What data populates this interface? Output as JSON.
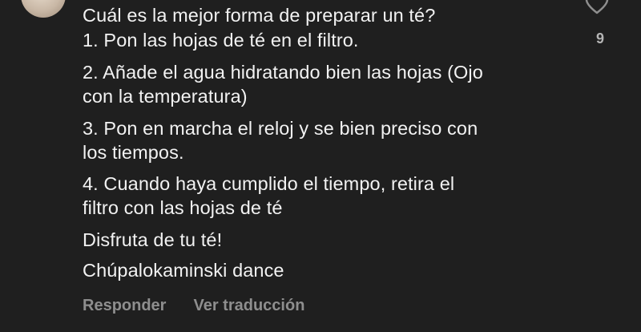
{
  "comment": {
    "question": "Cuál es la mejor forma de preparar un té?",
    "steps": [
      "1. Pon las hojas de té en el filtro.",
      "2. Añade el agua hidratando bien las hojas (Ojo\ncon la temperatura)",
      "3. Pon en marcha el reloj y se bien preciso con\nlos tiempos.",
      "4. Cuando haya cumplido el tiempo, retira el\nfiltro con las hojas de té",
      "Disfruta de tu té!",
      "Chúpalokaminski dance"
    ]
  },
  "actions": {
    "reply_label": "Responder",
    "translate_label": "Ver traducción"
  },
  "like": {
    "count": "9",
    "icon": "heart-outline-icon"
  },
  "colors": {
    "background": "#1f1f1f",
    "text": "#f2f2f2",
    "muted": "#8e8e8e"
  }
}
